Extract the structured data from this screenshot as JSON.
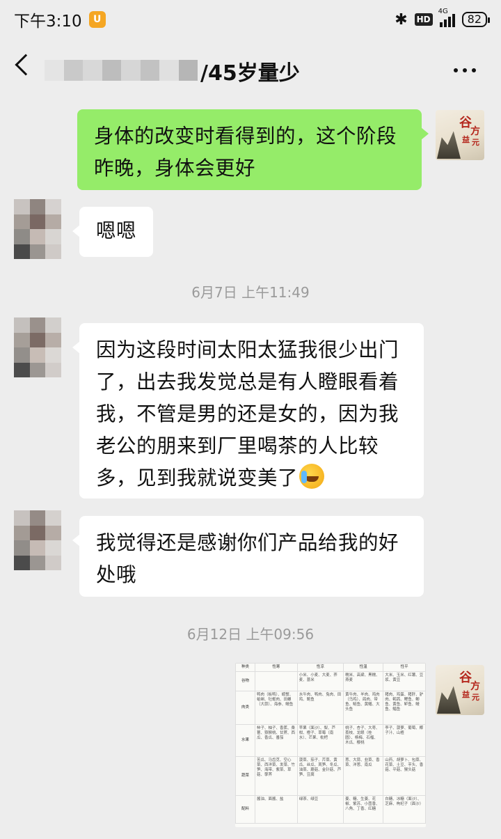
{
  "status": {
    "time": "下午3:10",
    "hd": "HD",
    "network": "4G",
    "battery": "82"
  },
  "nav": {
    "title_suffix": "/45岁量少"
  },
  "messages": [
    {
      "side": "right",
      "text": "身体的改变时看得到的，这个阶段昨晚，身体会更好"
    },
    {
      "side": "left",
      "text": "嗯嗯"
    },
    {
      "side": "left",
      "text": "因为这段时间太阳太猛我很少出门了，出去我发觉总是有人瞪眼看着我，不管是男的还是女的，因为我老公的朋来到厂里喝茶的人比较多，见到我就说变美了"
    },
    {
      "side": "left",
      "text": "我觉得还是感谢你们产品给我的好处哦"
    }
  ],
  "timestamps": [
    "6月7日 上午11:49",
    "6月12日 上午09:56"
  ],
  "logo_avatar": {
    "chars": [
      "谷",
      "方",
      "益",
      "元"
    ]
  },
  "image_message": {
    "headers": [
      "种类",
      "性寒",
      "性凉",
      "性温",
      "性平"
    ],
    "rows": [
      {
        "label": "谷物",
        "cells": [
          "",
          "小米、小麦、大麦、荞麦、薏米",
          "糯米、高粱、黑糯、燕麦",
          "大米、玉米、红薯、豆浆、黄豆"
        ]
      },
      {
        "label": "肉类",
        "cells": [
          "鸭肉（板鸭）、螃蟹、蛤蜊、牡蛎肉、田螺（大蒜）、海参、鳗鱼",
          "水牛肉、鸭肉、兔肉、田鸡、鲍鱼",
          "黄牛肉、羊肉、鸡肉（乌鸡）、鸽肉、带鱼、鲢鱼、黄鳝、大头鱼",
          "猪肉、鸡蛋、猪肝、驴肉、鹌鹑、鲤鱼、鲫鱼、黄鱼、鲈鱼、鳗鱼、鲳鱼"
        ]
      },
      {
        "label": "水果",
        "cells": [
          "柿子、柚子、香蕉、桑葚、猕猴桃、甘蔗、西瓜、香瓜、番茄",
          "苹果（面沙）、梨、芦柑、橙子、草莓（南水）、芒果、枇杷",
          "桃子、杏子、大枣、荔枝、龙眼（桂圆）、杨梅、石榴、木瓜、樱桃",
          "李子、菠萝、葡萄、椰子汁、山楂"
        ]
      },
      {
        "label": "蔬菜",
        "cells": [
          "苦瓜、马齿苋、空心菜、西洋菜、发菜、竹笋、海带、紫菜、草菇、荸荠",
          "菠菜、茄子、芹菜、黄瓜、丝瓜、莴笋、冬瓜、油菜、蘑菇、金针菇、芦笋、豆腐",
          "葱、大蒜、韭菜、香菜、洋葱、南瓜",
          "山药、胡萝卜、包菜、花菜、土豆、芋头、香菇、平菇、猴头菇"
        ]
      },
      {
        "label": "配料",
        "cells": [
          "酱油、面酱、盐",
          "绿茶、绿豆",
          "姜、糖、生姜、花椒、紫苏、小茴香、八角、丁香、红糖",
          "白糖、冰糖（面沙）、芝麻、枸杞子（面沙）"
        ]
      }
    ]
  },
  "colors": {
    "background": "#ededed",
    "bubble_right": "#95ec69",
    "bubble_left": "#ffffff"
  }
}
